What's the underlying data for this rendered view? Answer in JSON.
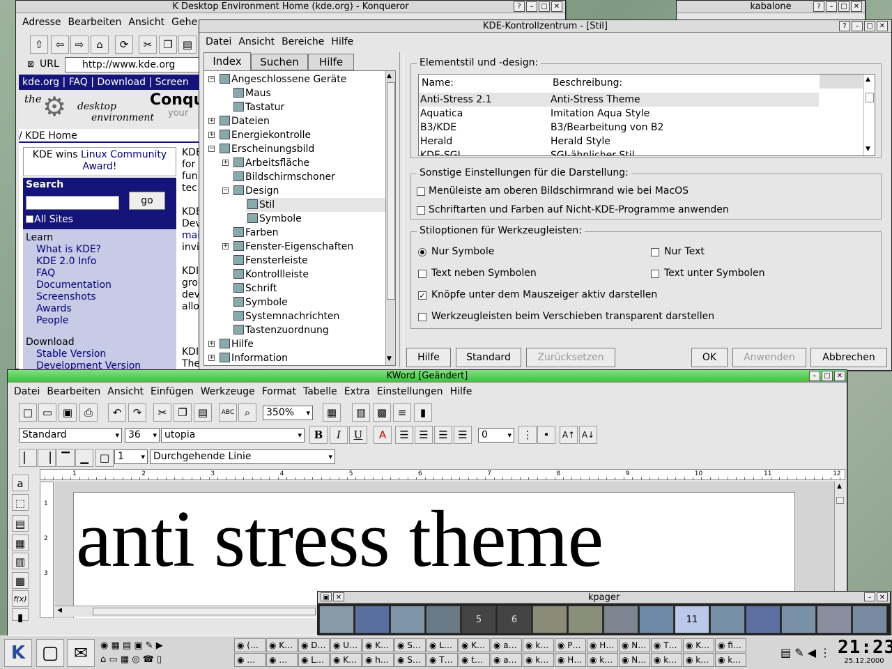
{
  "konqueror": {
    "title": "K Desktop Environment Home (kde.org) - Konqueror",
    "menu": [
      "Adresse",
      "Bearbeiten",
      "Ansicht",
      "Gehe"
    ],
    "url_label": "URL",
    "url": "http://www.kde.org",
    "topnav": "kde.org |  FAQ |  Download |  Screen",
    "banner_title": "Conqu",
    "banner_sub": "your",
    "logo_the": "the",
    "logo_desktop": "desktop",
    "logo_env": "environment",
    "breadcrumb": "/ KDE Home",
    "award_text": "KDE wins ",
    "award_link": "Linux Community",
    "award_text2": "Award!",
    "search_label": "Search",
    "go_label": "go",
    "all_sites": "All Sites",
    "learn_label": "Learn",
    "learn_links": [
      "What is KDE?",
      "KDE 2.0 Info",
      "FAQ",
      "Documentation",
      "Screenshots",
      "Awards",
      "People"
    ],
    "download_label": "Download",
    "download_links": [
      "Stable Version",
      "Development Version"
    ],
    "content_lines": [
      "KDE",
      "for",
      "fun",
      "tec",
      "",
      "KDE",
      "Dev",
      "mai",
      "invi",
      "",
      "KDI",
      "gro",
      "dev",
      "allo",
      "",
      "",
      "",
      "KDI",
      "The"
    ]
  },
  "kabalone": {
    "title": "kabalone"
  },
  "kcontrol": {
    "title": "KDE-Kontrollzentrum - [Stil]",
    "menu": [
      "Datei",
      "Ansicht",
      "Bereiche",
      "Hilfe"
    ],
    "tabs": [
      "Index",
      "Suchen",
      "Hilfe"
    ],
    "tree": [
      {
        "label": "Angeschlossene Geräte",
        "level": 0,
        "exp": "−"
      },
      {
        "label": "Maus",
        "level": 1
      },
      {
        "label": "Tastatur",
        "level": 1
      },
      {
        "label": "Dateien",
        "level": 0,
        "exp": "+"
      },
      {
        "label": "Energiekontrolle",
        "level": 0,
        "exp": "+"
      },
      {
        "label": "Erscheinungsbild",
        "level": 0,
        "exp": "−"
      },
      {
        "label": "Arbeitsfläche",
        "level": 1,
        "exp": "+"
      },
      {
        "label": "Bildschirmschoner",
        "level": 1
      },
      {
        "label": "Design",
        "level": 1,
        "exp": "−"
      },
      {
        "label": "Stil",
        "level": 2,
        "selected": true
      },
      {
        "label": "Symbole",
        "level": 2
      },
      {
        "label": "Farben",
        "level": 1
      },
      {
        "label": "Fenster-Eigenschaften",
        "level": 1,
        "exp": "+"
      },
      {
        "label": "Fensterleiste",
        "level": 1
      },
      {
        "label": "Kontrollleiste",
        "level": 1
      },
      {
        "label": "Schrift",
        "level": 1
      },
      {
        "label": "Symbole",
        "level": 1
      },
      {
        "label": "Systemnachrichten",
        "level": 1
      },
      {
        "label": "Tastenzuordnung",
        "level": 1
      },
      {
        "label": "Hilfe",
        "level": 0,
        "exp": "+"
      },
      {
        "label": "Information",
        "level": 0,
        "exp": "+"
      }
    ],
    "style_group_title": "Elementstil und -design:",
    "col_name": "Name:",
    "col_desc": "Beschreibung:",
    "styles": [
      {
        "name": "Anti-Stress 2.1",
        "desc": "Anti-Stress Theme"
      },
      {
        "name": "Aquatica",
        "desc": "Imitation Aqua Style"
      },
      {
        "name": "B3/KDE",
        "desc": "B3/Bearbeitung von B2"
      },
      {
        "name": "Herald",
        "desc": "Herald Style"
      },
      {
        "name": "KDE-SGI",
        "desc": "SGI-ähnlicher Stil"
      }
    ],
    "misc_group_title": "Sonstige Einstellungen für die Darstellung:",
    "misc_opts": [
      "Menüleiste am oberen Bildschirmrand wie bei MacOS",
      "Schriftarten und Farben auf Nicht-KDE-Programme anwenden"
    ],
    "toolbar_group_title": "Stiloptionen für Werkzeugleisten:",
    "radio_icons_only": "Nur Symbole",
    "radio_text_only": "Nur Text",
    "radio_text_beside": "Text neben Symbolen",
    "radio_text_under": "Text unter Symbolen",
    "check_hover": "Knöpfe unter dem Mauszeiger aktiv darstellen",
    "check_transparent": "Werkzeugleisten beim Verschieben transparent darstellen",
    "buttons": {
      "help": "Hilfe",
      "default": "Standard",
      "reset": "Zurücksetzen",
      "ok": "OK",
      "apply": "Anwenden",
      "cancel": "Abbrechen"
    }
  },
  "kword": {
    "title": "KWord [Geändert]",
    "menu": [
      "Datei",
      "Bearbeiten",
      "Ansicht",
      "Einfügen",
      "Werkzeuge",
      "Format",
      "Tabelle",
      "Extra",
      "Einstellungen",
      "Hilfe"
    ],
    "zoom": "350%",
    "style": "Standard",
    "font_size": "36",
    "font": "utopia",
    "indent": "0",
    "border_width": "1",
    "border_style": "Durchgehende Linie",
    "ruler_numbers": [
      "1",
      "2",
      "3",
      "4",
      "5",
      "6",
      "7",
      "8",
      "9",
      "10",
      "11",
      "12"
    ],
    "vruler_numbers": [
      "1",
      "2",
      "3"
    ],
    "doc_text": "anti stress theme"
  },
  "kpager": {
    "title": "kpager",
    "desks": [
      "",
      "",
      "",
      "",
      "5",
      "6",
      "",
      "",
      "",
      "",
      "11",
      "",
      "",
      "",
      "",
      ""
    ]
  },
  "taskbar": {
    "row1": [
      "(…",
      "K…",
      "D…",
      "U…",
      "K…",
      "S…",
      "L…",
      "K…",
      "a…",
      "k…",
      "P…",
      "H…",
      "N…",
      "T…",
      "K…",
      "fi…"
    ],
    "row2": [
      "…",
      "…",
      "L…",
      "K…",
      "h…",
      "S…",
      "T…",
      "t…",
      "a…",
      "k…",
      "H…",
      "k…",
      "N…",
      "k…",
      "k…",
      "k…"
    ],
    "clock": "21:23",
    "date": "25.12.2000"
  }
}
